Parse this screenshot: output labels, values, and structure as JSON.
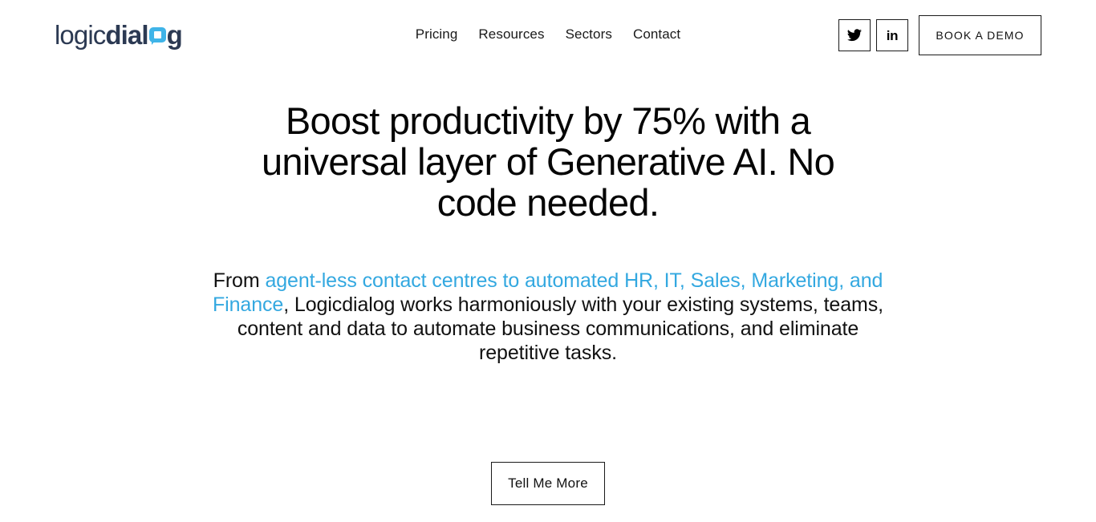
{
  "brand": {
    "logo_part1": "logic",
    "logo_part2": "dial",
    "logo_part3": "g",
    "bubble_icon": "speech-bubble-icon",
    "navy": "#2c3a53",
    "blue": "#3fb4e8"
  },
  "nav": {
    "items": [
      {
        "label": "Pricing"
      },
      {
        "label": "Resources"
      },
      {
        "label": "Sectors"
      },
      {
        "label": "Contact"
      }
    ]
  },
  "header": {
    "social": [
      {
        "name": "twitter",
        "icon": "twitter-icon",
        "label": "Twitter"
      },
      {
        "name": "linkedin",
        "icon": "linkedin-icon",
        "label": "in"
      }
    ],
    "demo_button_label": "BOOK A DEMO"
  },
  "hero": {
    "heading": "Boost productivity by 75% with a universal layer of Generative AI. No code needed.",
    "sub_prefix": "From ",
    "sub_link": "agent-less contact centres to automated HR, IT, Sales, Marketing, and Finance",
    "sub_suffix": ", Logicdialog works harmoniously with your existing systems, teams, content and data to automate business communications, and eliminate repetitive tasks.",
    "cta_label": "Tell Me More",
    "link_color": "#33a8e0"
  }
}
